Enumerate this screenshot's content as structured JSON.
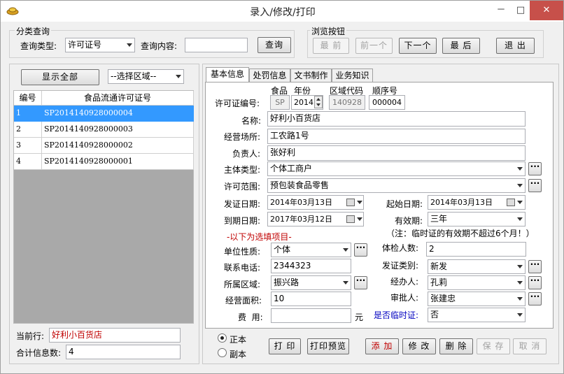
{
  "window": {
    "title": "录入/修改/打印",
    "minimize": "－",
    "maximize": "□",
    "close": "✕"
  },
  "classify_group": {
    "title": "分类查询",
    "query_type_label": "查询类型:",
    "query_type_value": "许可证号",
    "query_content_label": "查询内容:",
    "query_content_value": "",
    "query_button": "查询"
  },
  "browse_group": {
    "title": "浏览按钮",
    "first": "最 前",
    "prev": "前一个",
    "next": "下一个",
    "last": "最 后",
    "exit": "退 出"
  },
  "left_panel": {
    "show_all": "显示全部",
    "region_select": "--选择区域--",
    "columns": [
      "编号",
      "食品流通许可证号"
    ],
    "rows": [
      [
        "1",
        "SP2014140928000004"
      ],
      [
        "2",
        "SP2014140928000003"
      ],
      [
        "3",
        "SP2014140928000002"
      ],
      [
        "4",
        "SP2014140928000001"
      ]
    ],
    "selected_row": 0,
    "current_row_label": "当前行:",
    "current_row_value": "好利小百货店",
    "total_label": "合计信息数:",
    "total_value": "4"
  },
  "tabs": [
    "基本信息",
    "处罚信息",
    "文书制作",
    "业务知识"
  ],
  "form": {
    "license_label": "许可证编号:",
    "food_head": "食品",
    "year_head": "年份",
    "region_head": "区域代码",
    "seq_head": "顺序号",
    "food_value": "SP",
    "year_value": "2014",
    "region_value": "140928",
    "seq_value": "000004",
    "name_label": "名称:",
    "name_value": "好利小百货店",
    "place_label": "经营场所:",
    "place_value": "工农路1号",
    "owner_label": "负责人:",
    "owner_value": "张好利",
    "subject_label": "主体类型:",
    "subject_value": "个体工商户",
    "scope_label": "许可范围:",
    "scope_value": "预包装食品零售",
    "issue_label": "发证日期:",
    "issue_value": "2014年03月13日",
    "start_label": "起始日期:",
    "start_value": "2014年03月13日",
    "expire_label": "到期日期:",
    "expire_value": "2017年03月12日",
    "valid_label": "有效期:",
    "valid_value": "三年",
    "note": "（注：临时证的有效期不超过6个月！）",
    "optional_title": "-以下为选填项目-",
    "unit_label": "单位性质:",
    "unit_value": "个体",
    "exam_label": "体检人数:",
    "exam_value": "2",
    "phone_label": "联系电话:",
    "phone_value": "2344323",
    "cert_type_label": "发证类别:",
    "cert_type_value": "新发",
    "area_region_label": "所属区域:",
    "area_region_value": "振兴路",
    "handler_label": "经办人:",
    "handler_value": "孔莉",
    "area_label": "经营面积:",
    "area_value": "10",
    "approver_label": "审批人:",
    "approver_value": "张建忠",
    "fee_label": "费  用:",
    "fee_value": "",
    "fee_unit": "元",
    "temp_label": "是否临时证:",
    "temp_value": "否"
  },
  "bottom": {
    "original": "正本",
    "copy": "副本",
    "print": "打 印",
    "preview": "打印预览",
    "add": "添 加",
    "modify": "修 改",
    "delete": "删 除",
    "save": "保 存",
    "cancel": "取 消"
  },
  "colors": {
    "selection": "#3399ff",
    "red_text": "#c00000",
    "blue_text": "#0000c0"
  }
}
